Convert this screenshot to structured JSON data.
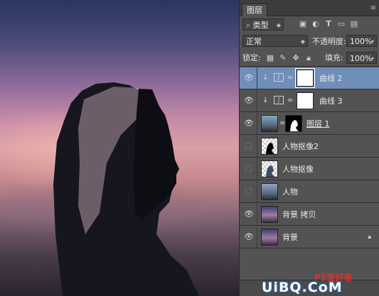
{
  "panel": {
    "tab_label": "图层",
    "filter": {
      "icon": "search-icon",
      "value": "类型"
    },
    "blend_mode": "正常",
    "opacity_label": "不透明度:",
    "opacity_value": "100%",
    "lock_label": "锁定:",
    "fill_label": "填充:",
    "fill_value": "100%"
  },
  "layers": [
    {
      "name": "曲线 2",
      "visible": true,
      "selected": true,
      "type": "curves-adjustment",
      "clipped": true
    },
    {
      "name": "曲线 3",
      "visible": true,
      "selected": false,
      "type": "curves-adjustment",
      "clipped": true
    },
    {
      "name": "图层 1",
      "visible": true,
      "selected": false,
      "type": "pixel-with-mask"
    },
    {
      "name": "人物抠像2",
      "visible": false,
      "selected": false,
      "type": "pixel"
    },
    {
      "name": "人物抠像",
      "visible": false,
      "selected": false,
      "type": "pixel"
    },
    {
      "name": "人物",
      "visible": false,
      "selected": false,
      "type": "pixel"
    },
    {
      "name": "背景 拷贝",
      "visible": true,
      "selected": false,
      "type": "pixel"
    },
    {
      "name": "背景",
      "visible": true,
      "selected": false,
      "type": "background",
      "locked": true
    }
  ],
  "watermark": {
    "small": "PS爱好者",
    "big": "UiBQ.CoM"
  }
}
